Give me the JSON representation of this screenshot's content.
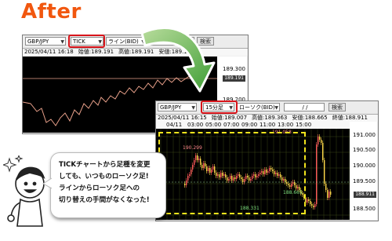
{
  "heading": "After",
  "before_window": {
    "pair": "GBP/JPY",
    "type": "TICK",
    "line": "ライン(BID)",
    "search": "検索",
    "info": [
      "2025/04/11 16:18",
      "始値:189.191",
      "高値:189.191",
      "安値:189.191"
    ],
    "yaxis": [
      "189.300",
      "189.191",
      "189.200"
    ],
    "price_tag": "189.191"
  },
  "after_window": {
    "pair": "GBP/JPY",
    "interval": "15分足",
    "style": "ローソク(BID)",
    "date": "/ /",
    "search": "検索",
    "info": [
      "2025/04/11 16:15",
      "始値:189.007",
      "高値:189.363",
      "安値:188.665",
      "終値:188.911"
    ],
    "time_labels": [
      "04/11",
      "03:00",
      "05:00",
      "07:00",
      "09:00",
      "11:00",
      "13:00",
      "15:00"
    ],
    "yaxis": [
      "191.000",
      "190.500",
      "190.000",
      "189.500",
      "188.911",
      "188.500",
      "188.000"
    ],
    "price_tag": "188.911",
    "annotations": [
      "190.299",
      "191.058",
      "188.665",
      "188.331"
    ]
  },
  "bubble_lines": [
    "TICKチャートから足種を変更",
    "しても、いつものローソク足!",
    "ラインからローソク足への",
    "切り替えの手間がなくなった!"
  ],
  "colors": {
    "heading": "#f1570f",
    "highlight": "#d8141a",
    "arrow": "#4aa63a",
    "dashed": "#f2e41d"
  }
}
